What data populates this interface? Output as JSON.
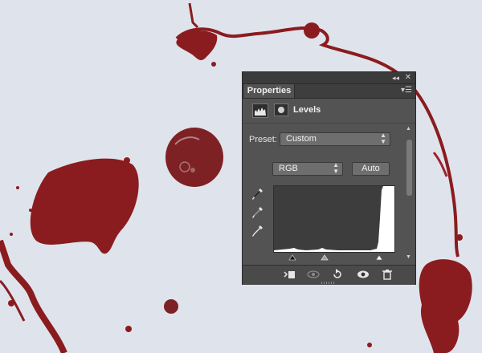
{
  "panel": {
    "collapse_icon": "double-chevron-left-icon",
    "close_icon": "close-icon",
    "tab_label": "Properties",
    "menu_icon": "panel-menu-icon"
  },
  "adjustment": {
    "title": "Levels",
    "icon": "levels-icon",
    "mask_icon": "mask-icon"
  },
  "preset": {
    "label": "Preset:",
    "value": "Custom"
  },
  "channel": {
    "value": "RGB"
  },
  "auto_button": {
    "label": "Auto"
  },
  "eyedroppers": [
    "black-eyedropper-icon",
    "gray-eyedropper-icon",
    "white-eyedropper-icon"
  ],
  "bottom_toolbar": [
    "clip-to-layer-icon",
    "view-previous-icon",
    "reset-icon",
    "visibility-eye-icon",
    "trash-icon"
  ],
  "colors": {
    "canvas": "#dfe4ec",
    "blood": "#8a1c1f",
    "panel_bg": "#535353",
    "histogram_bg": "#3d3d3d"
  }
}
